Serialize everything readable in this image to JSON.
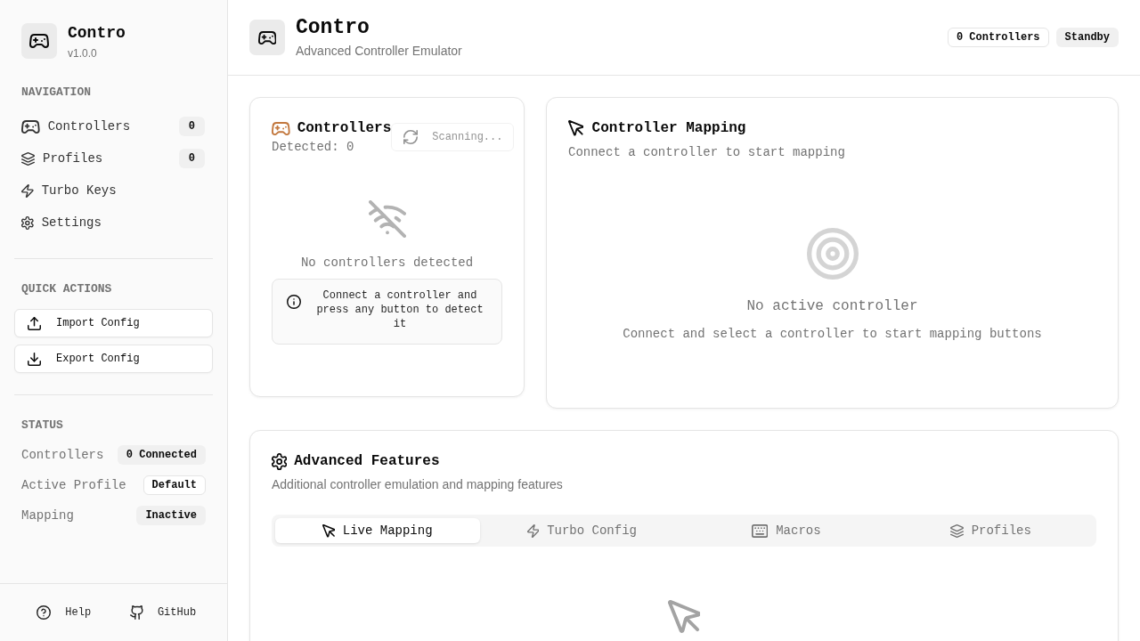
{
  "sidebar": {
    "logo": {
      "title": "Contro",
      "version": "v1.0.0"
    },
    "navigation": {
      "heading": "NAVIGATION",
      "items": [
        {
          "label": "Controllers",
          "badge": "0",
          "selected": false
        },
        {
          "label": "Profiles",
          "badge": "0",
          "selected": false
        },
        {
          "label": "Turbo Keys",
          "selected": false
        },
        {
          "label": "Settings",
          "selected": false
        }
      ]
    },
    "quick_actions": {
      "heading": "QUICK ACTIONS",
      "buttons": [
        "Import Config",
        "Export Config"
      ]
    },
    "status": {
      "heading": "STATUS",
      "rows": [
        {
          "label": "Controllers",
          "value": "0 Connected",
          "kind": "secondary"
        },
        {
          "label": "Active Profile",
          "value": "Default",
          "kind": "outline"
        },
        {
          "label": "Mapping",
          "value": "Inactive",
          "kind": "secondary"
        }
      ]
    },
    "footer": [
      "Help",
      "GitHub"
    ]
  },
  "header": {
    "title": "Contro",
    "subtitle": "Advanced Controller Emulator",
    "badges": [
      {
        "text": "0 Controllers",
        "kind": "outline"
      },
      {
        "text": "Standby",
        "kind": "secondary"
      }
    ]
  },
  "controllers_card": {
    "title": "Controllers",
    "detected": "Detected: 0",
    "scan_button": {
      "label": "Scanning...",
      "disabled": true
    },
    "empty_message": "No controllers detected",
    "hint": "Connect a controller and press any button to detect it"
  },
  "mapping_card": {
    "title": "Controller Mapping",
    "subtitle": "Connect a controller to start mapping",
    "empty_title": "No active controller",
    "empty_message": "Connect and select a controller to start mapping buttons"
  },
  "features_card": {
    "title": "Advanced Features",
    "subtitle": "Additional controller emulation and mapping features",
    "tabs": [
      {
        "label": "Live Mapping",
        "selected": true
      },
      {
        "label": "Turbo Config",
        "selected": false
      },
      {
        "label": "Macros",
        "selected": false
      },
      {
        "label": "Profiles",
        "selected": false
      }
    ]
  }
}
